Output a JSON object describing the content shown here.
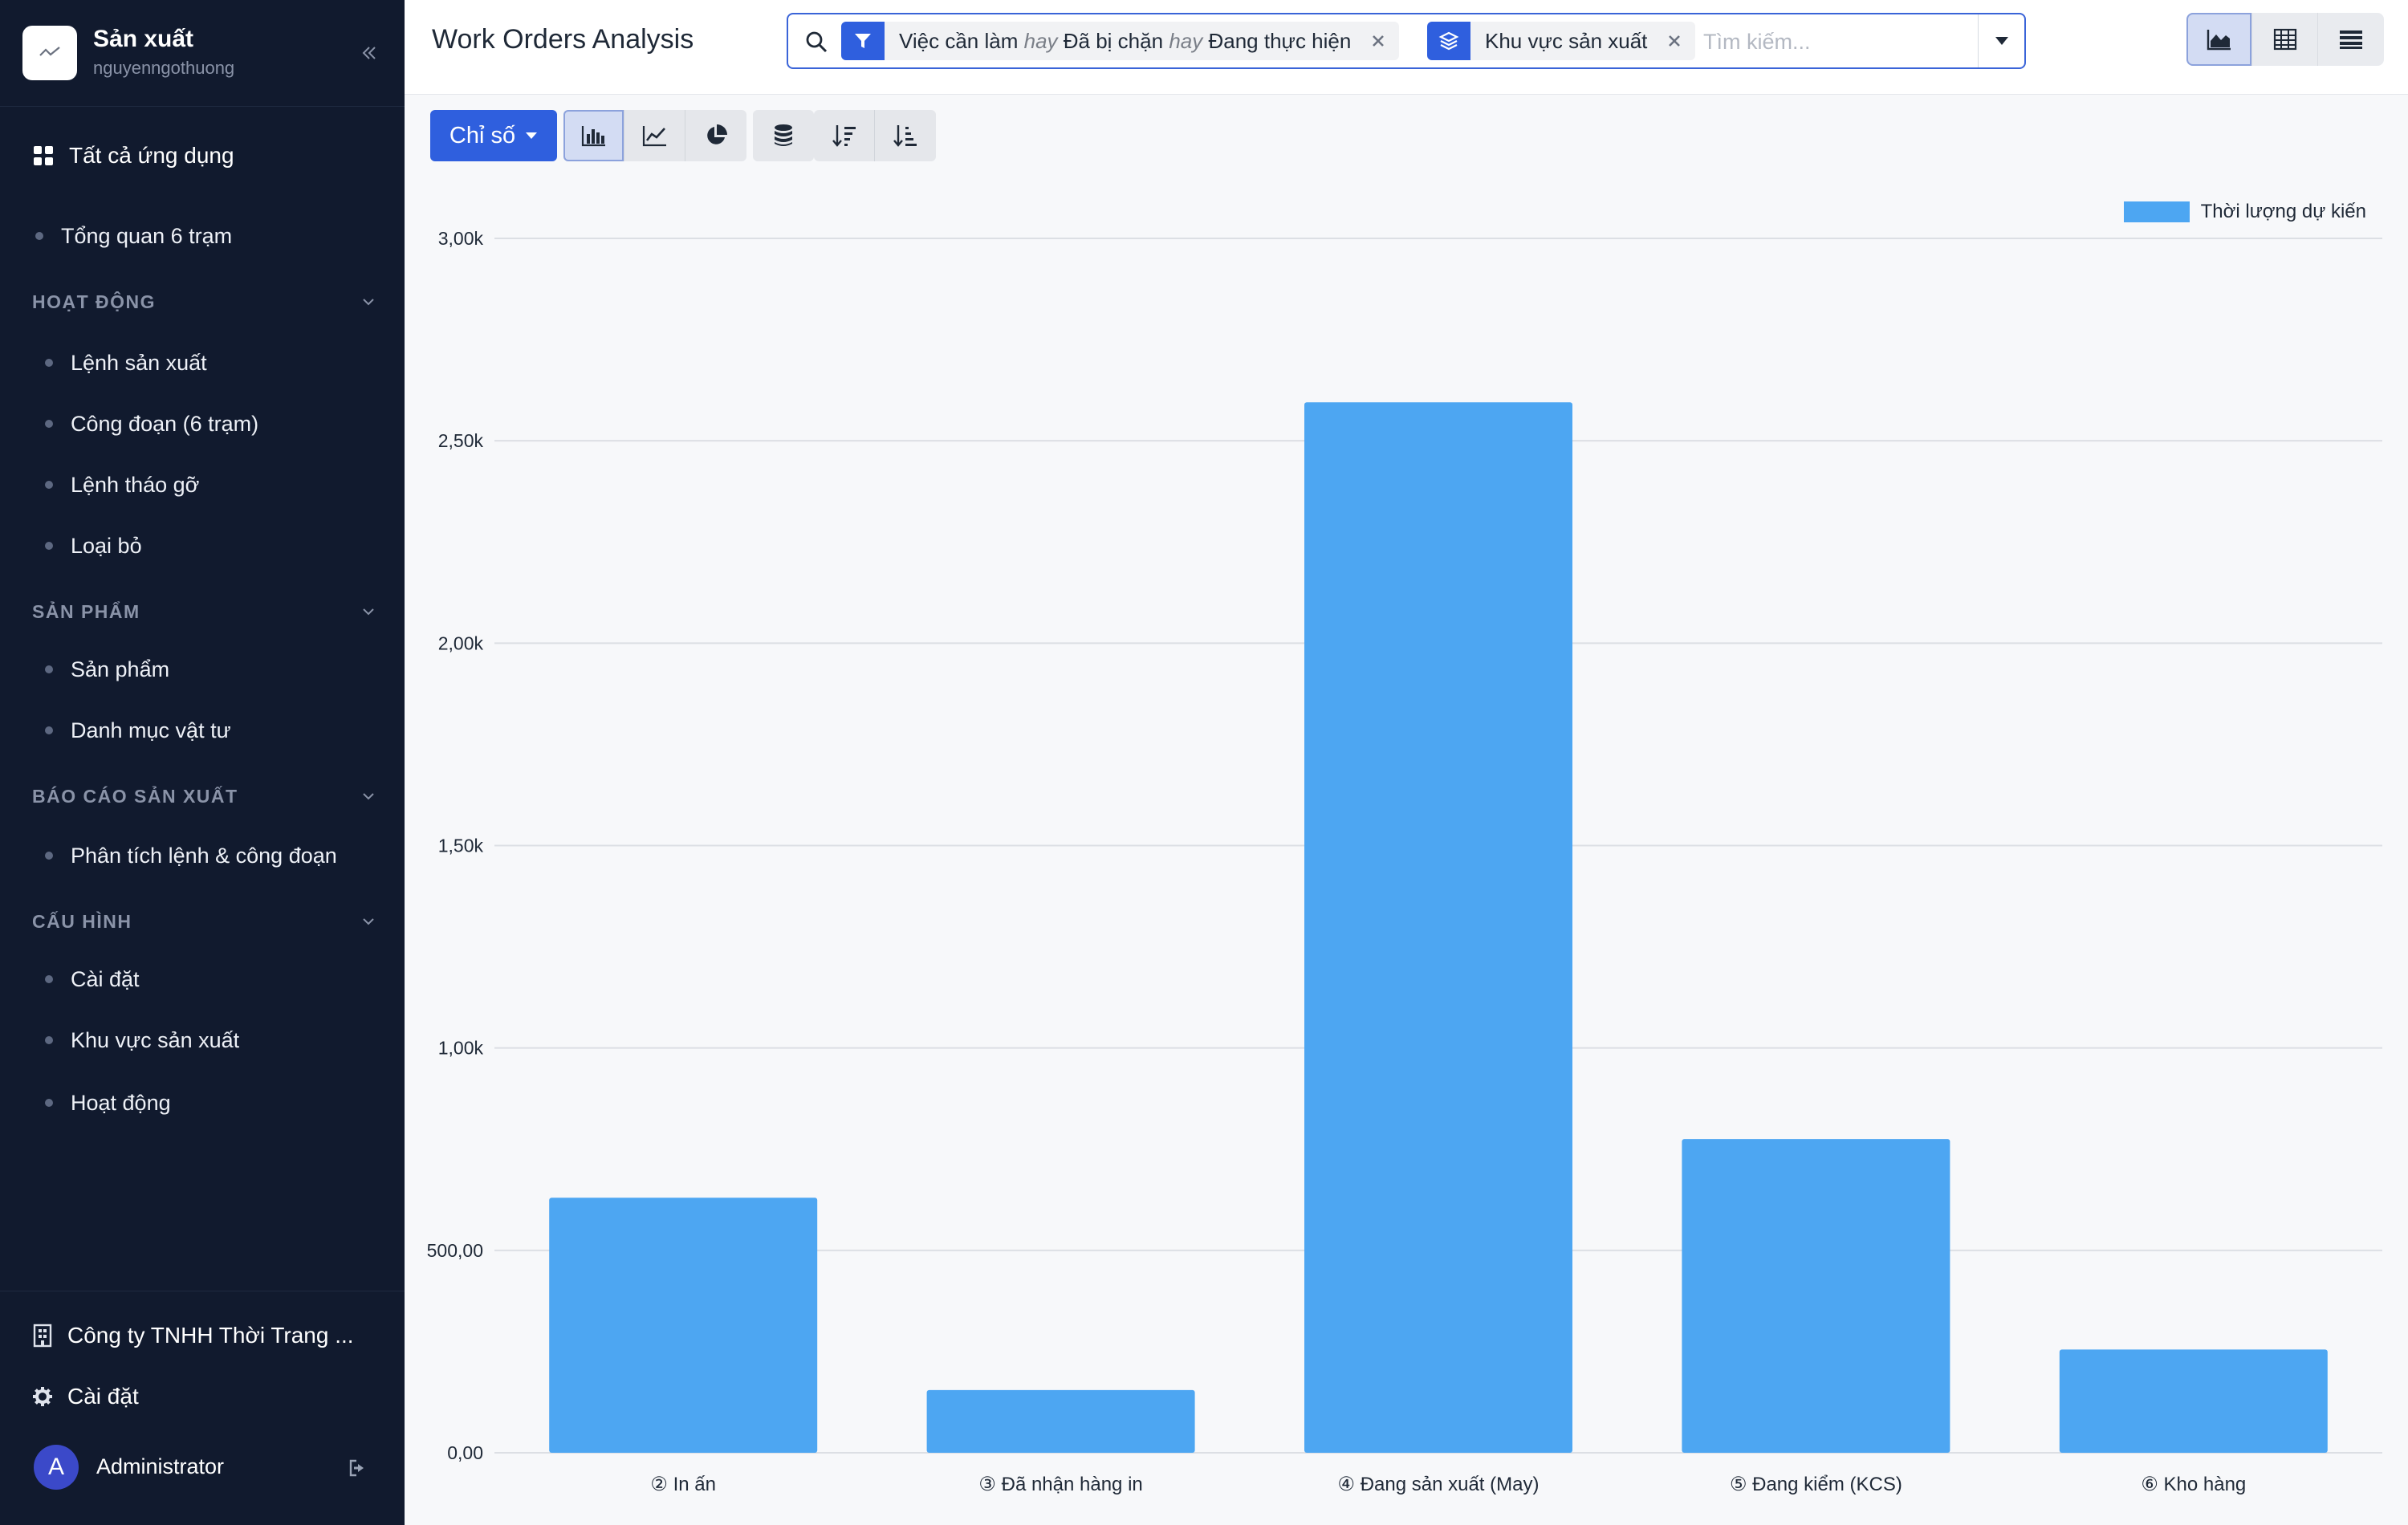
{
  "sidebar": {
    "app_name": "Sản xuất",
    "username": "nguyenngothuong",
    "all_apps": "Tất cả ứng dụng",
    "overview": "Tổng quan 6 trạm",
    "sections": [
      {
        "title": "HOẠT ĐỘNG",
        "items": [
          "Lệnh sản xuất",
          "Công đoạn (6 trạm)",
          "Lệnh tháo gỡ",
          "Loại bỏ"
        ]
      },
      {
        "title": "SẢN PHẨM",
        "items": [
          "Sản phẩm",
          "Danh mục vật tư"
        ]
      },
      {
        "title": "BÁO CÁO SẢN XUẤT",
        "items": [
          "Phân tích lệnh & công đoạn"
        ]
      },
      {
        "title": "CẤU HÌNH",
        "items": [
          "Cài đặt",
          "Khu vực sản xuất",
          "Hoạt động"
        ]
      }
    ],
    "company": "Công ty TNHH Thời Trang ...",
    "settings": "Cài đặt",
    "user_initial": "A",
    "user_name": "Administrator"
  },
  "header": {
    "title": "Work Orders Analysis",
    "filter_facet": {
      "values": [
        "Việc cần làm",
        "Đã bị chặn",
        "Đang thực hiện"
      ],
      "separator": "hay"
    },
    "groupby_facet": "Khu vực sản xuất",
    "search_placeholder": "Tìm kiếm...",
    "views": [
      "graph",
      "pivot",
      "list"
    ],
    "active_view": "graph"
  },
  "toolbar": {
    "measures_label": "Chỉ số",
    "chart_types": [
      "bar-chart-icon",
      "line-chart-icon",
      "pie-chart-icon"
    ],
    "active_chart_type": "bar-chart-icon"
  },
  "colors": {
    "accent": "#2f5fde",
    "sidebar_bg": "#111a2e",
    "bar": "#4da6f2"
  },
  "chart_data": {
    "type": "bar",
    "categories": [
      "② In ấn",
      "③ Đã nhận hàng in",
      "④ Đang sản xuất (May)",
      "⑤ Đang kiểm (KCS)",
      "⑥ Kho hàng"
    ],
    "series": [
      {
        "name": "Thời lượng dự kiến",
        "values": [
          630,
          155,
          2595,
          775,
          255
        ]
      }
    ],
    "ylim": [
      0,
      3000
    ],
    "yticks": [
      0,
      500,
      1000,
      1500,
      2000,
      2500,
      3000
    ],
    "ytick_labels": [
      "0,00",
      "500,00",
      "1,00k",
      "1,50k",
      "2,00k",
      "2,50k",
      "3,00k"
    ],
    "grid": true,
    "legend": "top-right"
  }
}
